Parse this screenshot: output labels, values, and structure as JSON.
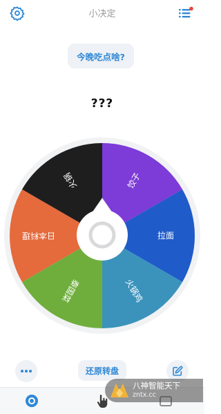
{
  "header": {
    "title": "小决定",
    "settings_icon": "gear-icon",
    "menu_icon": "list-icon",
    "notification_dot_color": "#e8453c"
  },
  "question": "今晚吃点啥?",
  "result": "???",
  "wheel": {
    "segments": [
      {
        "label": "饺子",
        "color": "#7d3bd8"
      },
      {
        "label": "拉面",
        "color": "#1f5bc9"
      },
      {
        "label": "火锅鸡",
        "color": "#3b93bc"
      },
      {
        "label": "泰国菜",
        "color": "#6fae3d"
      },
      {
        "label": "日本料理",
        "color": "#e56a3c"
      },
      {
        "label": "火锅",
        "color": "#1e1e1e"
      }
    ],
    "rim_color": "#f1f2f4",
    "hub_icon": "ring-icon"
  },
  "actions": {
    "more_icon": "more-dots-icon",
    "reset_label": "还原转盘",
    "edit_icon": "edit-icon",
    "accent_color": "#2f88d6"
  },
  "tabbar": {
    "items": [
      {
        "icon": "wheel-tab-icon",
        "active": true
      },
      {
        "icon": "hand-cursor-icon",
        "active": false
      },
      {
        "icon": "box-icon",
        "active": false
      }
    ]
  },
  "watermark": {
    "line1": "八神智能天下",
    "line2": "zntx.cc"
  }
}
